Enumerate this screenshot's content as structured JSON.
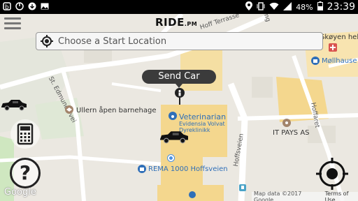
{
  "status_bar": {
    "battery": "48%",
    "time": "23:39"
  },
  "app": {
    "logo_main": "RIDE",
    "logo_suffix": ".PM"
  },
  "search": {
    "placeholder": "Choose a Start Location"
  },
  "send_car_label": "Send Car",
  "map_labels": {
    "hoff_terrasse": "Hoff Terrasse",
    "skoyen_helse": "Skøyen hel",
    "mollhaus": "Møllhause",
    "st_edmunds": "St. Edmunds vei",
    "ullern_barnehage": "Ullern åpen barnehage",
    "veterinarian": "Veterinarian",
    "evidensia_1": "Evidensia Volvat",
    "evidensia_2": "Dyreklinikk",
    "it_pays": "IT PAYS AS",
    "hoffsveien": "Hoffsveien",
    "hofferet": "Hoffaret",
    "rema": "REMA 1000 Hoffsveien",
    "eng": "Eng"
  },
  "google_logo": "Google",
  "attribution": {
    "map_data": "Map data ©2017 Google",
    "terms": "Terms of Use"
  },
  "colors": {
    "map_bg": "#ebe8e1",
    "road": "#ffffff",
    "park": "#c8e6b7",
    "building": "#f3d48f",
    "poi_blue": "#2f6fb8",
    "dark_button": "#3b3b3b"
  }
}
